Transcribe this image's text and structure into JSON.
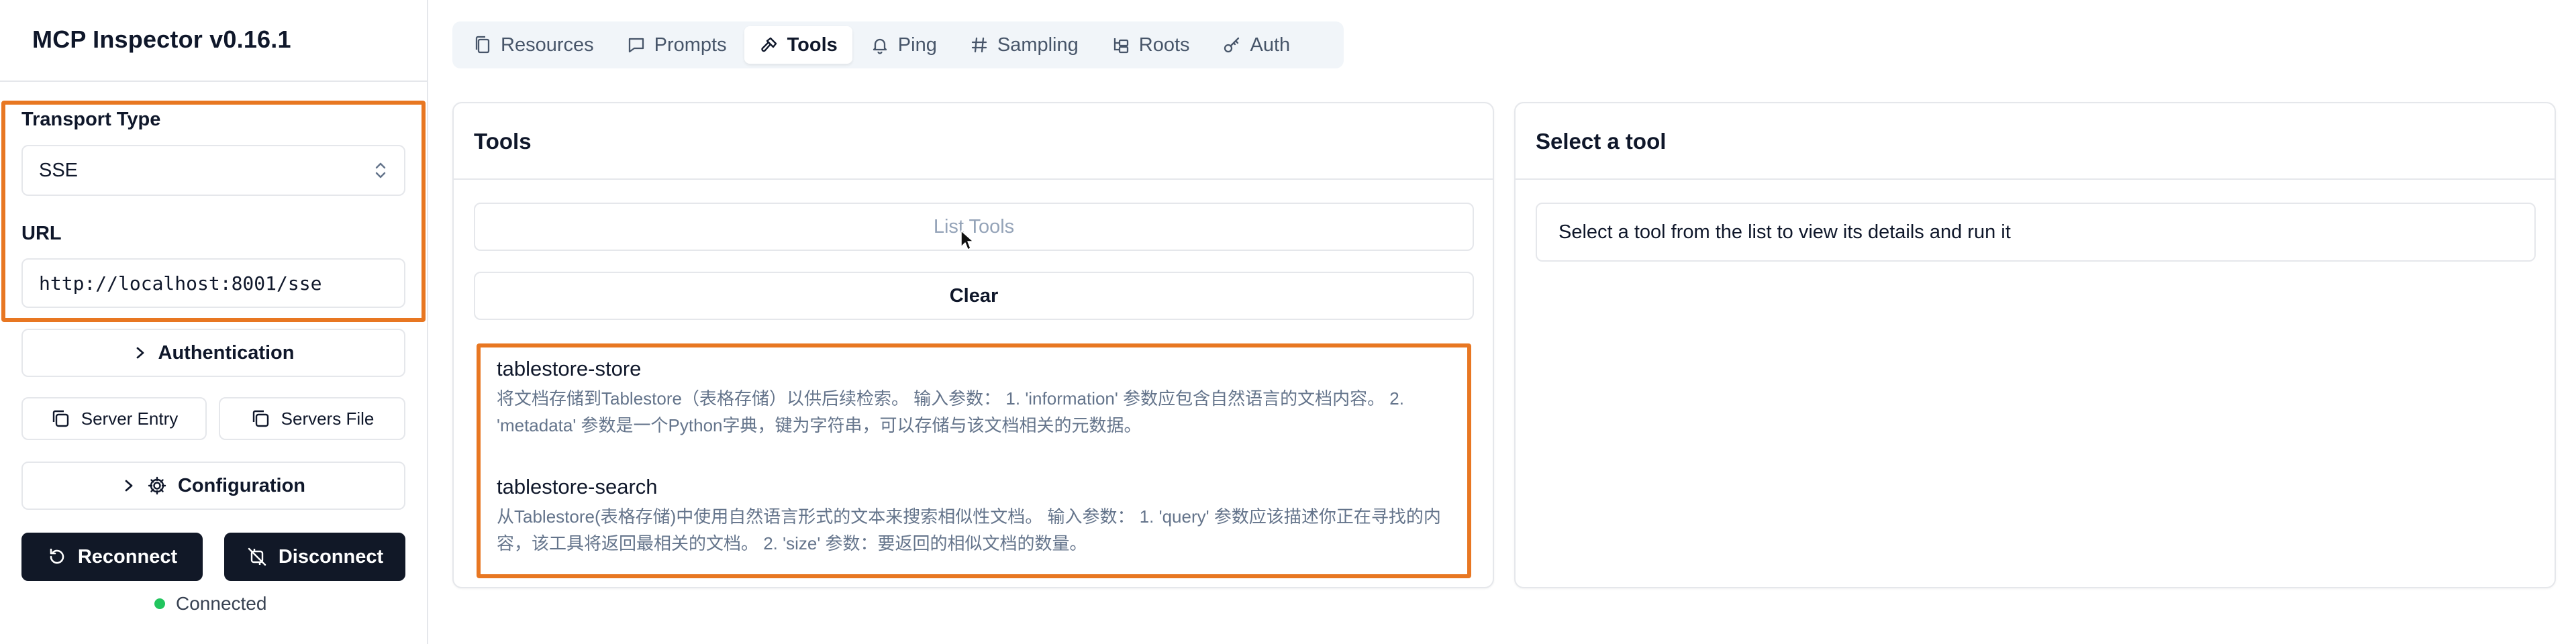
{
  "app": {
    "title": "MCP Inspector v0.16.1"
  },
  "sidebar": {
    "transport_type_label": "Transport Type",
    "transport_type_value": "SSE",
    "url_label": "URL",
    "url_value": "http://localhost:8001/sse",
    "authentication_label": "Authentication",
    "server_entry_label": "Server Entry",
    "servers_file_label": "Servers File",
    "configuration_label": "Configuration",
    "reconnect_label": "Reconnect",
    "disconnect_label": "Disconnect",
    "status": "Connected"
  },
  "tabs": [
    {
      "label": "Resources",
      "icon": "file-icon",
      "active": false
    },
    {
      "label": "Prompts",
      "icon": "message-icon",
      "active": false
    },
    {
      "label": "Tools",
      "icon": "hammer-icon",
      "active": true
    },
    {
      "label": "Ping",
      "icon": "bell-icon",
      "active": false
    },
    {
      "label": "Sampling",
      "icon": "hash-icon",
      "active": false
    },
    {
      "label": "Roots",
      "icon": "folder-tree-icon",
      "active": false
    },
    {
      "label": "Auth",
      "icon": "key-icon",
      "active": false
    }
  ],
  "tools_panel": {
    "title": "Tools",
    "list_tools_label": "List Tools",
    "clear_label": "Clear",
    "tools": [
      {
        "name": "tablestore-store",
        "description": "将文档存储到Tablestore（表格存储）以供后续检索。 输入参数： 1. 'information' 参数应包含自然语言的文档内容。 2. 'metadata' 参数是一个Python字典，键为字符串，可以存储与该文档相关的元数据。"
      },
      {
        "name": "tablestore-search",
        "description": "从Tablestore(表格存储)中使用自然语言形式的文本来搜索相似性文档。 输入参数： 1. 'query' 参数应该描述你正在寻找的内容，该工具将返回最相关的文档。 2. 'size' 参数：要返回的相似文档的数量。"
      }
    ]
  },
  "detail_panel": {
    "title": "Select a tool",
    "hint": "Select a tool from the list to view its details and run it"
  },
  "colors": {
    "highlight": "#e87722",
    "primary_dark": "#111827",
    "status_green": "#22c55e",
    "border": "#e5e7eb"
  }
}
